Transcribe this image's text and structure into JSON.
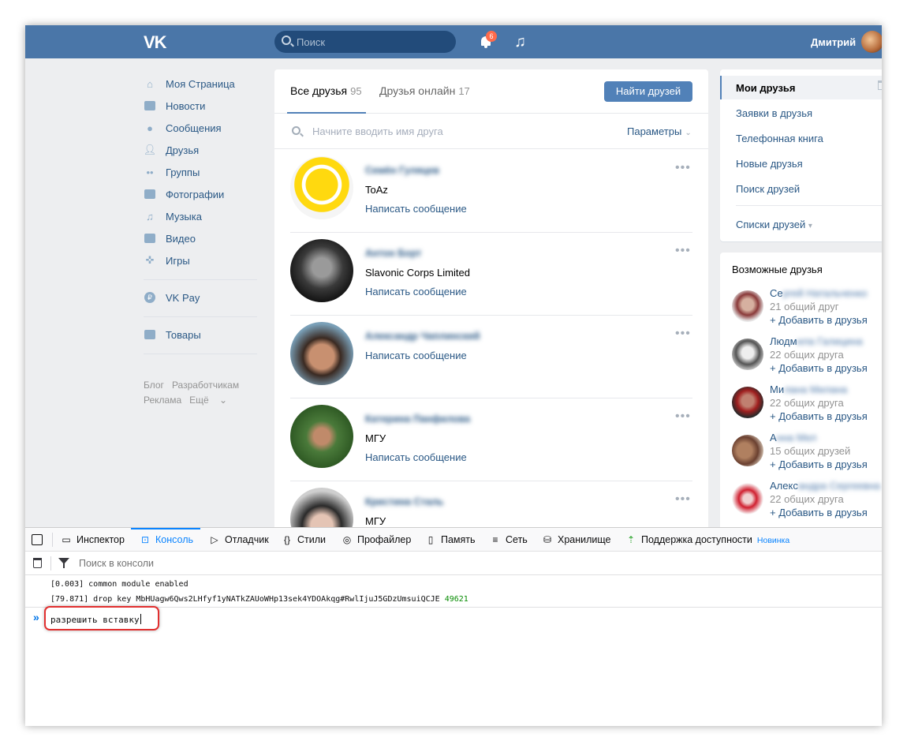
{
  "header": {
    "logo": "VK",
    "search_placeholder": "Поиск",
    "notifications_count": "6",
    "user_name": "Дмитрий"
  },
  "left_nav": {
    "items": [
      {
        "label": "Моя Страница",
        "icon": "home-icon"
      },
      {
        "label": "Новости",
        "icon": "news-icon"
      },
      {
        "label": "Сообщения",
        "icon": "messages-icon"
      },
      {
        "label": "Друзья",
        "icon": "friends-icon"
      },
      {
        "label": "Группы",
        "icon": "groups-icon"
      },
      {
        "label": "Фотографии",
        "icon": "camera-icon"
      },
      {
        "label": "Музыка",
        "icon": "music-icon"
      },
      {
        "label": "Видео",
        "icon": "video-icon"
      },
      {
        "label": "Игры",
        "icon": "gamepad-icon"
      }
    ],
    "vkpay": "VK Pay",
    "goods": "Товары",
    "footer": [
      "Блог",
      "Разработчикам",
      "Реклама",
      "Ещё"
    ]
  },
  "main": {
    "tab_all_label": "Все друзья",
    "tab_all_count": "95",
    "tab_online_label": "Друзья онлайн",
    "tab_online_count": "17",
    "find_button": "Найти друзей",
    "search_placeholder": "Начните вводить имя друга",
    "params_label": "Параметры",
    "friends": [
      {
        "name": "Семён Гуляцев",
        "sub": "ToAz",
        "action": "Написать сообщение"
      },
      {
        "name": "Антон Борт",
        "sub": "Slavonic Corps Limited",
        "action": "Написать сообщение"
      },
      {
        "name": "Александр Чаплинский",
        "sub": "",
        "action": "Написать сообщение"
      },
      {
        "name": "Катерина Панфилова",
        "sub": "МГУ",
        "action": "Написать сообщение"
      },
      {
        "name": "Кристина Сталь",
        "sub": "МГУ",
        "action": ""
      }
    ]
  },
  "right_menu": {
    "items": [
      "Мои друзья",
      "Заявки в друзья",
      "Телефонная книга",
      "Новые друзья",
      "Поиск друзей"
    ],
    "lists": "Списки друзей"
  },
  "possible_friends": {
    "title": "Возможные друзья",
    "add_label": "+ Добавить в друзья",
    "people": [
      {
        "name_visible": "Се",
        "name_hidden": "ргей Натальченко",
        "mutual": "21 общий друг"
      },
      {
        "name_visible": "Людм",
        "name_hidden": "ила Галицина",
        "mutual": "22 общих друга"
      },
      {
        "name_visible": "Ми",
        "name_hidden": "лана Милана",
        "mutual": "22 общих друга"
      },
      {
        "name_visible": "А",
        "name_hidden": "нна Мел",
        "mutual": "15 общих друзей"
      },
      {
        "name_visible": "Алекс",
        "name_hidden": "андра Сергеевна",
        "mutual": "22 общих друга"
      }
    ]
  },
  "devtools": {
    "tabs": [
      "Инспектор",
      "Консоль",
      "Отладчик",
      "Стили",
      "Профайлер",
      "Память",
      "Сеть",
      "Хранилище",
      "Поддержка доступности"
    ],
    "new_badge": "Новинка",
    "filter_placeholder": "Поиск в консоли",
    "log1": "[0.003]  common module enabled",
    "log2_text": "[79.871]  drop key MbHUagw6Qws2LHfyf1yNATkZAUoWHp13sek4YDOAkqg#RwlIjuJ5GDzUmsuiQCJE",
    "log2_num": "49621",
    "prompt": "»",
    "input_value": "разрешить вставку"
  },
  "colors": {
    "header_bg": "#4a76a8",
    "link": "#2a5885",
    "button": "#5181b8",
    "highlight_border": "#e12f2f"
  }
}
